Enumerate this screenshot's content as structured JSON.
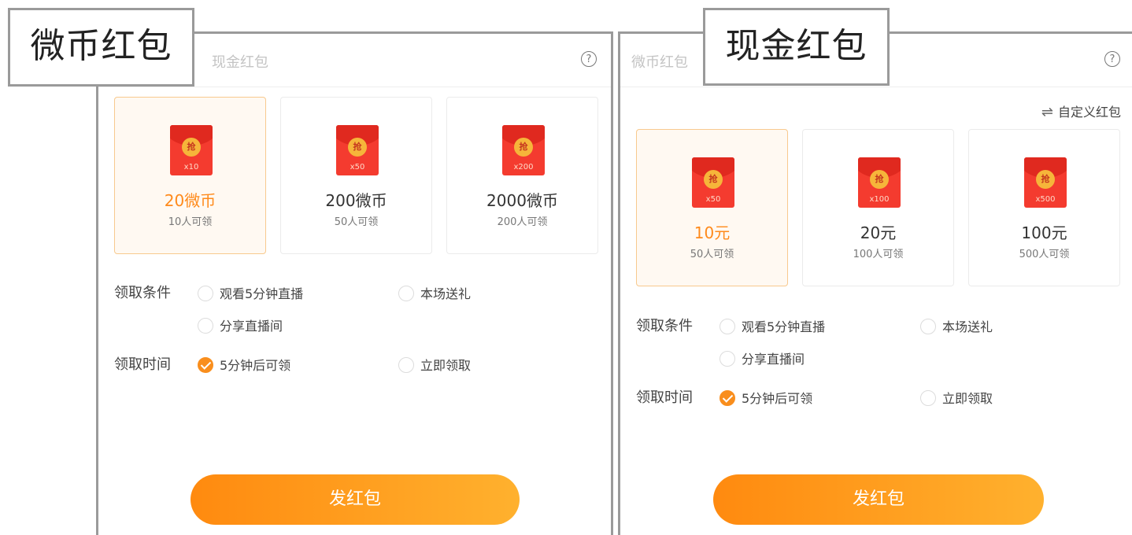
{
  "left": {
    "title_label": "微币红包",
    "tab_other": "现金红包",
    "help_glyph": "?",
    "cards": [
      {
        "badge": "抢",
        "qty": "x10",
        "amount": "20微币",
        "people": "10人可领",
        "selected": true
      },
      {
        "badge": "抢",
        "qty": "x50",
        "amount": "200微币",
        "people": "50人可领",
        "selected": false
      },
      {
        "badge": "抢",
        "qty": "x200",
        "amount": "2000微币",
        "people": "200人可领",
        "selected": false
      }
    ],
    "condition_label": "领取条件",
    "conditions": [
      "观看5分钟直播",
      "本场送礼",
      "分享直播间"
    ],
    "time_label": "领取时间",
    "times": [
      "5分钟后可领",
      "立即领取"
    ],
    "send_label": "发红包"
  },
  "right": {
    "title_label": "现金红包",
    "tab_other": "微币红包",
    "help_glyph": "?",
    "custom_label": "自定义红包",
    "custom_icon": "swap-icon",
    "cards": [
      {
        "badge": "抢",
        "qty": "x50",
        "amount": "10元",
        "people": "50人可领",
        "selected": true
      },
      {
        "badge": "抢",
        "qty": "x100",
        "amount": "20元",
        "people": "100人可领",
        "selected": false
      },
      {
        "badge": "抢",
        "qty": "x500",
        "amount": "100元",
        "people": "500人可领",
        "selected": false
      }
    ],
    "condition_label": "领取条件",
    "conditions": [
      "观看5分钟直播",
      "本场送礼",
      "分享直播间"
    ],
    "time_label": "领取时间",
    "times": [
      "5分钟后可领",
      "立即领取"
    ],
    "send_label": "发红包"
  },
  "colors": {
    "accent": "#ff8a1b",
    "envelope": "#f43b2f",
    "seal": "#f6b53a"
  }
}
